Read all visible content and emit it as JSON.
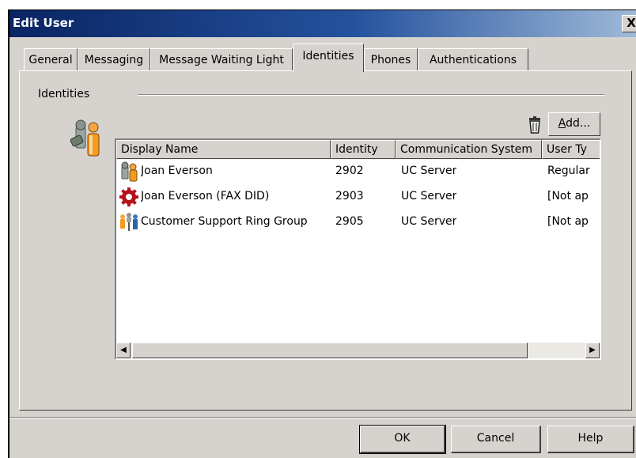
{
  "window": {
    "title": "Edit User",
    "close_label": "X"
  },
  "tabs": [
    {
      "label": "General",
      "active": false
    },
    {
      "label": "Messaging",
      "active": false
    },
    {
      "label": "Message Waiting Light",
      "active": false
    },
    {
      "label": "Identities",
      "active": true
    },
    {
      "label": "Phones",
      "active": false
    },
    {
      "label": "Authentications",
      "active": false
    }
  ],
  "group": {
    "label": "Identities",
    "add_prefix": "",
    "add_accel": "A",
    "add_rest": "dd...",
    "delete_icon": "trash-icon"
  },
  "list": {
    "columns": [
      "Display Name",
      "Identity",
      "Communication System",
      "User Ty"
    ],
    "rows": [
      {
        "icon": "user-icon",
        "display_name": "Joan Everson",
        "identity": "2902",
        "system": "UC Server",
        "user_type": "Regular"
      },
      {
        "icon": "fax-icon",
        "display_name": "Joan Everson (FAX DID)",
        "identity": "2903",
        "system": "UC Server",
        "user_type": "[Not ap"
      },
      {
        "icon": "group-icon",
        "display_name": "Customer Support Ring Group",
        "identity": "2905",
        "system": "UC Server",
        "user_type": "[Not ap"
      }
    ]
  },
  "buttons": {
    "ok": "OK",
    "cancel": "Cancel",
    "help": "Help"
  },
  "colors": {
    "title_start": "#0a2463",
    "title_end": "#9fb9d8",
    "face": "#d6d3ce",
    "fax_red": "#b5121b"
  }
}
